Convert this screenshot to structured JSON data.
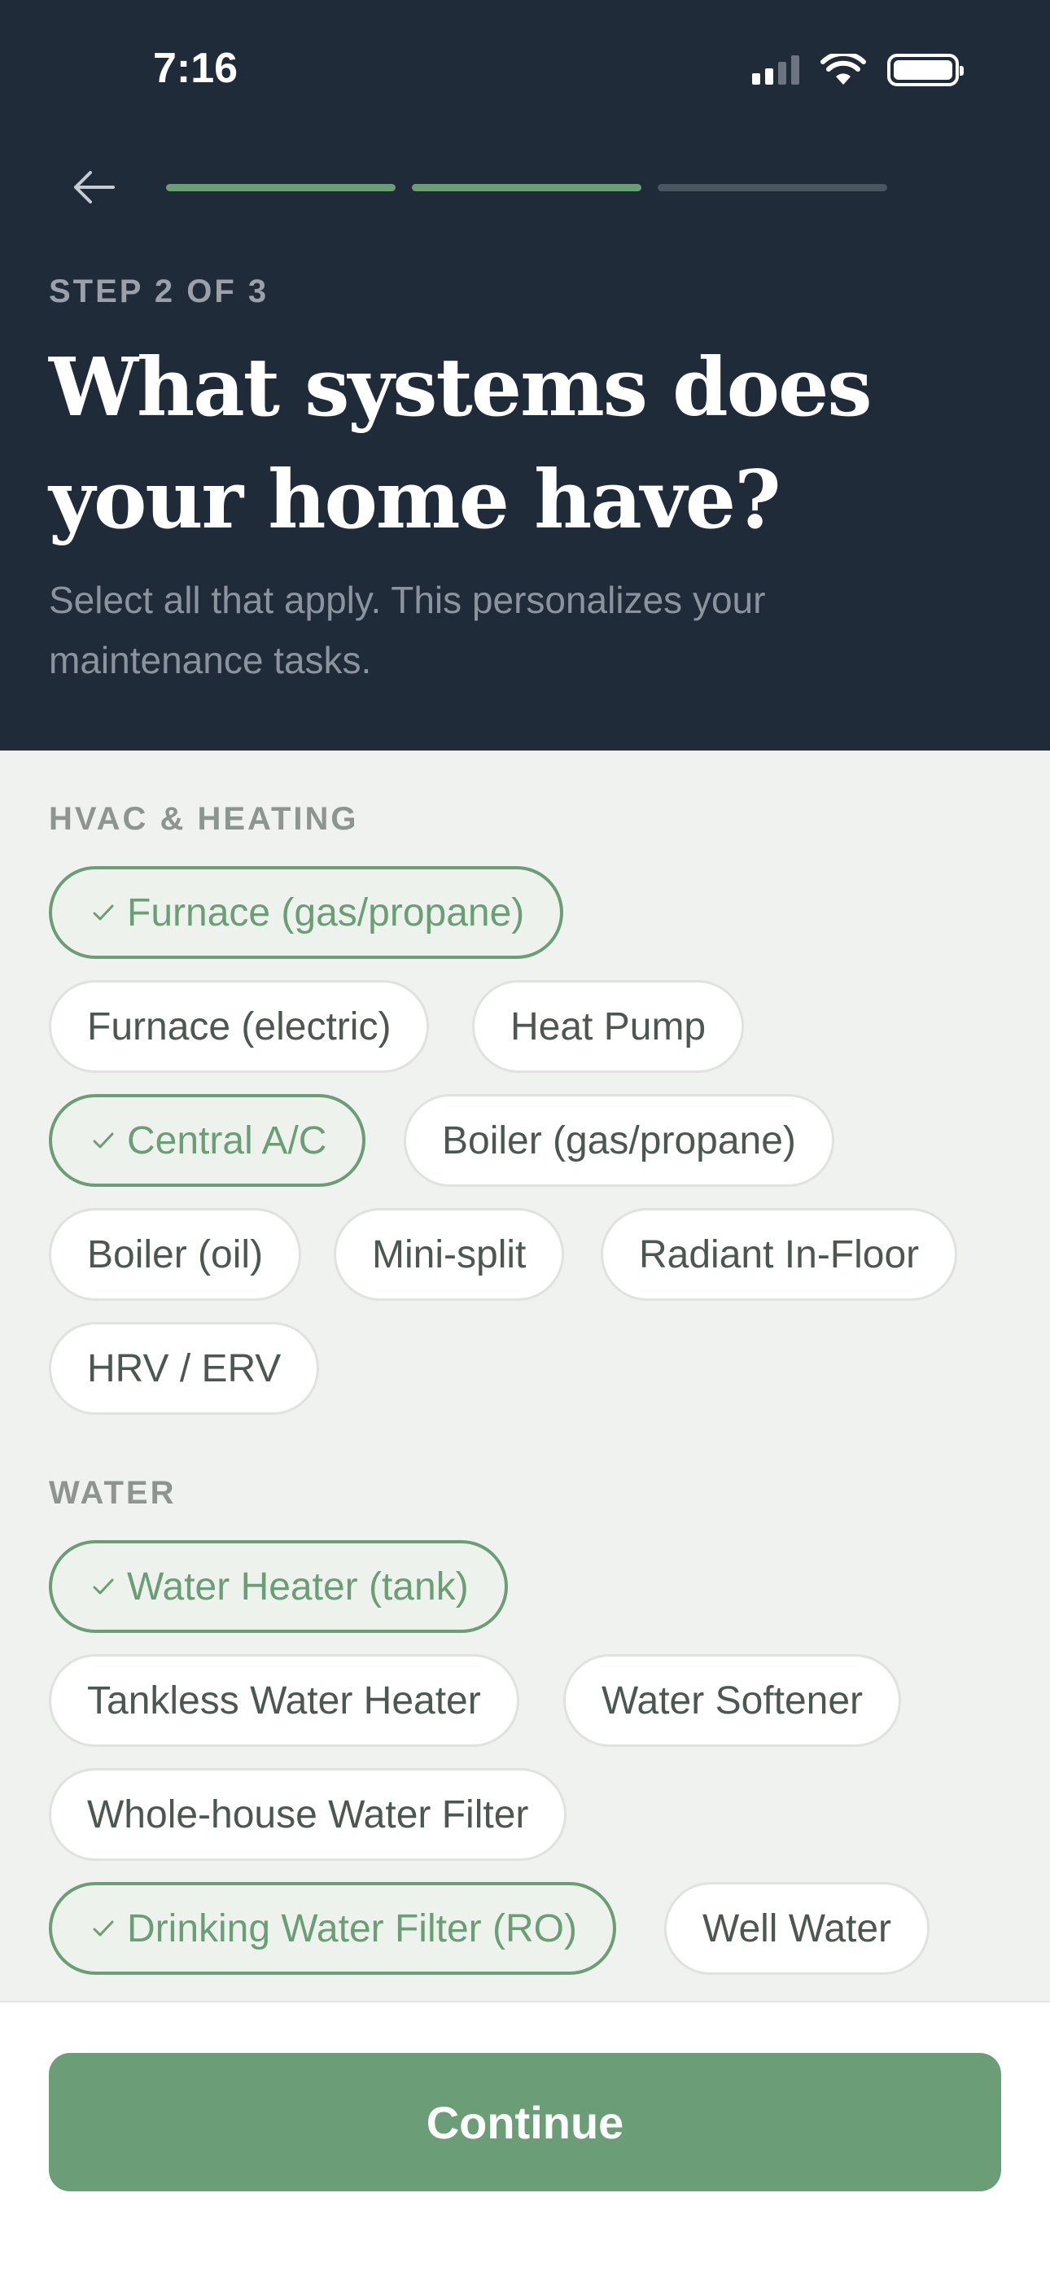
{
  "status_bar": {
    "time": "7:16"
  },
  "progress": {
    "total_steps": 3,
    "completed": 2
  },
  "header": {
    "step_label": "STEP 2 OF 3",
    "title": "What systems does your home have?",
    "subtitle": "Select all that apply. This personalizes your maintenance tasks."
  },
  "sections": [
    {
      "label": "HVAC & HEATING",
      "chips": [
        {
          "label": "Furnace (gas/propane)",
          "selected": true
        },
        {
          "label": "Furnace (electric)",
          "selected": false
        },
        {
          "label": "Heat Pump",
          "selected": false
        },
        {
          "label": "Central A/C",
          "selected": true
        },
        {
          "label": "Boiler (gas/propane)",
          "selected": false
        },
        {
          "label": "Boiler (oil)",
          "selected": false
        },
        {
          "label": "Mini-split",
          "selected": false
        },
        {
          "label": "Radiant In-Floor",
          "selected": false
        },
        {
          "label": "HRV / ERV",
          "selected": false
        }
      ]
    },
    {
      "label": "WATER",
      "chips": [
        {
          "label": "Water Heater (tank)",
          "selected": true
        },
        {
          "label": "Tankless Water Heater",
          "selected": false
        },
        {
          "label": "Water Softener",
          "selected": false
        },
        {
          "label": "Whole-house Water Filter",
          "selected": false
        },
        {
          "label": "Drinking Water Filter (RO)",
          "selected": true
        },
        {
          "label": "Well Water",
          "selected": false
        }
      ]
    }
  ],
  "footer": {
    "continue_label": "Continue"
  },
  "colors": {
    "header_bg": "#1f2b38",
    "accent": "#6b9e76",
    "content_bg": "#eff2ee"
  }
}
